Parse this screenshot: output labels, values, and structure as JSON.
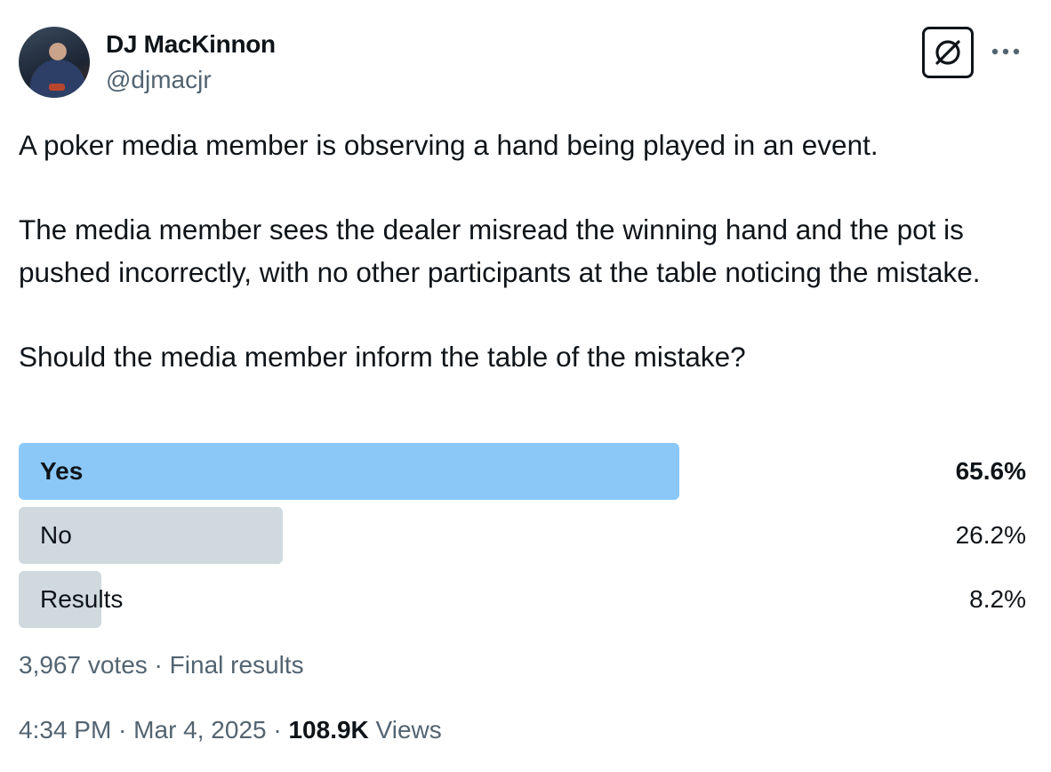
{
  "author": {
    "name": "DJ MacKinnon",
    "handle": "@djmacjr"
  },
  "icons": {
    "grok": "grok-icon",
    "more": "more-horizontal-icon"
  },
  "tweet": {
    "paragraphs": [
      "A poker media member is observing a hand being played in an event.",
      "The media member sees the dealer misread the winning hand and the pot is pushed incorrectly, with no other participants at the table noticing the mistake.",
      "Should the media member inform the table of the mistake?"
    ]
  },
  "poll": {
    "options": [
      {
        "label": "Yes",
        "percent_text": "65.6%",
        "percent": 65.6
      },
      {
        "label": "No",
        "percent_text": "26.2%",
        "percent": 26.2
      },
      {
        "label": "Results",
        "percent_text": "8.2%",
        "percent": 8.2
      }
    ],
    "votes": "3,967 votes",
    "separator": " · ",
    "status": "Final results"
  },
  "meta": {
    "time": "4:34 PM",
    "separator": " · ",
    "date": "Mar 4, 2025",
    "views_count": "108.9K",
    "views_label": " Views"
  },
  "colors": {
    "winner_bar": "#8bc8f7",
    "other_bar": "#cfd9de",
    "secondary_text": "#536471",
    "primary_text": "#0f1419"
  }
}
